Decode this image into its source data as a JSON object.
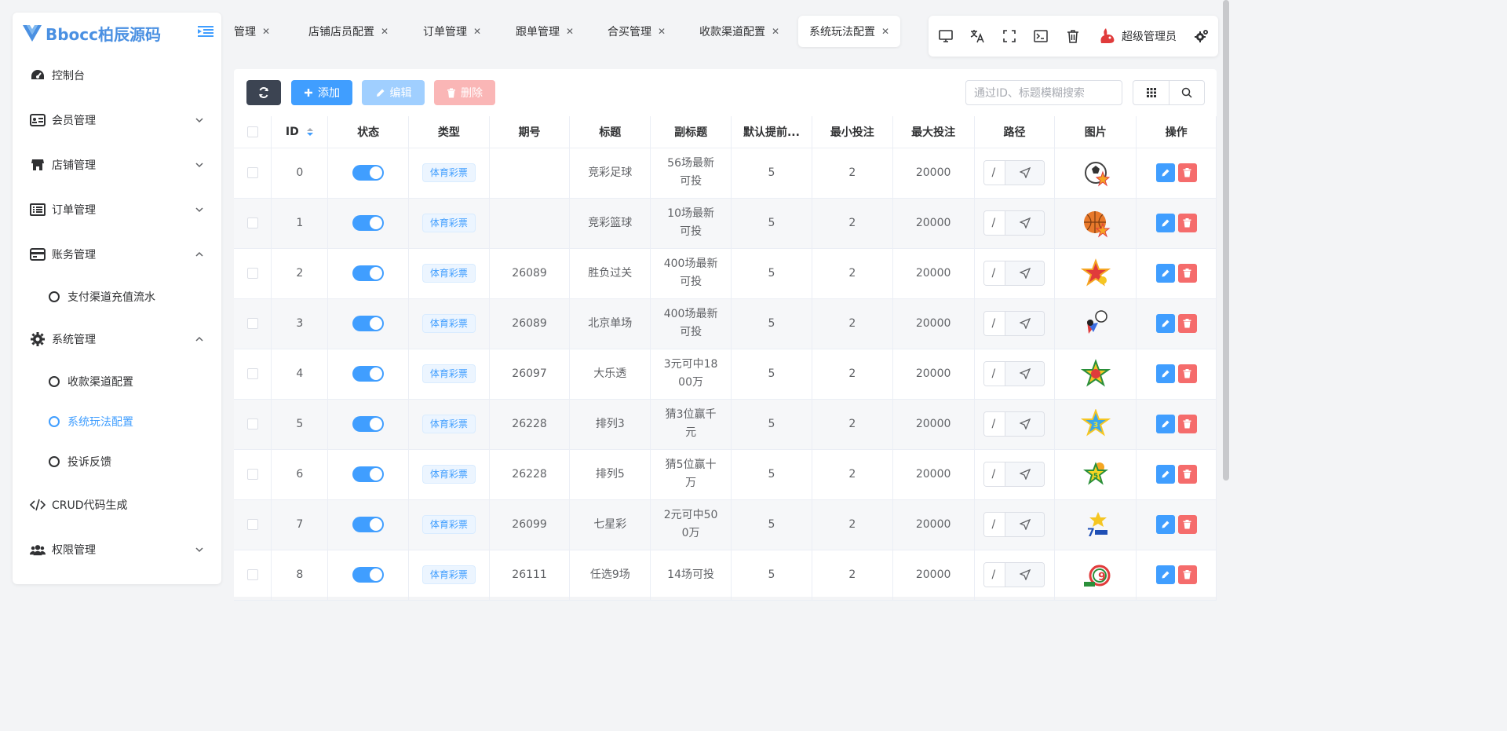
{
  "app": {
    "title": "Bbocc柏辰源码"
  },
  "sidebar": {
    "items": [
      {
        "label": "控制台",
        "icon": "dashboard-icon"
      },
      {
        "label": "会员管理",
        "icon": "id-card-icon"
      },
      {
        "label": "店铺管理",
        "icon": "store-icon"
      },
      {
        "label": "订单管理",
        "icon": "list-icon"
      },
      {
        "label": "账务管理",
        "icon": "credit-card-icon"
      },
      {
        "label": "系统管理",
        "icon": "gear-icon"
      },
      {
        "label": "CRUD代码生成",
        "icon": "code-icon"
      },
      {
        "label": "权限管理",
        "icon": "users-icon"
      }
    ],
    "finance_sub": [
      {
        "label": "支付渠道充值流水"
      }
    ],
    "system_sub": [
      {
        "label": "收款渠道配置"
      },
      {
        "label": "系统玩法配置"
      },
      {
        "label": "投诉反馈"
      }
    ]
  },
  "tabs": [
    {
      "label": "管理"
    },
    {
      "label": "店铺店员配置"
    },
    {
      "label": "订单管理"
    },
    {
      "label": "跟单管理"
    },
    {
      "label": "合买管理"
    },
    {
      "label": "收款渠道配置"
    },
    {
      "label": "系统玩法配置"
    }
  ],
  "header": {
    "user": "超级管理员"
  },
  "toolbar": {
    "add_label": "添加",
    "edit_label": "编辑",
    "delete_label": "删除",
    "search_placeholder": "通过ID、标题模糊搜索"
  },
  "table": {
    "columns": [
      "ID",
      "状态",
      "类型",
      "期号",
      "标题",
      "副标题",
      "默认提前...",
      "最小投注",
      "最大投注",
      "路径",
      "图片",
      "操作"
    ],
    "rows": [
      {
        "id": "0",
        "type": "体育彩票",
        "issue": "",
        "title": "竞彩足球",
        "subtitle": "56场最新可投",
        "advance": "5",
        "min": "2",
        "max": "20000",
        "path": "/"
      },
      {
        "id": "1",
        "type": "体育彩票",
        "issue": "",
        "title": "竞彩篮球",
        "subtitle": "10场最新可投",
        "advance": "5",
        "min": "2",
        "max": "20000",
        "path": "/"
      },
      {
        "id": "2",
        "type": "体育彩票",
        "issue": "26089",
        "title": "胜负过关",
        "subtitle": "400场最新可投",
        "advance": "5",
        "min": "2",
        "max": "20000",
        "path": "/"
      },
      {
        "id": "3",
        "type": "体育彩票",
        "issue": "26089",
        "title": "北京单场",
        "subtitle": "400场最新可投",
        "advance": "5",
        "min": "2",
        "max": "20000",
        "path": "/"
      },
      {
        "id": "4",
        "type": "体育彩票",
        "issue": "26097",
        "title": "大乐透",
        "subtitle": "3元可中1800万",
        "advance": "5",
        "min": "2",
        "max": "20000",
        "path": "/"
      },
      {
        "id": "5",
        "type": "体育彩票",
        "issue": "26228",
        "title": "排列3",
        "subtitle": "猜3位赢千元",
        "advance": "5",
        "min": "2",
        "max": "20000",
        "path": "/"
      },
      {
        "id": "6",
        "type": "体育彩票",
        "issue": "26228",
        "title": "排列5",
        "subtitle": "猜5位赢十万",
        "advance": "5",
        "min": "2",
        "max": "20000",
        "path": "/"
      },
      {
        "id": "7",
        "type": "体育彩票",
        "issue": "26099",
        "title": "七星彩",
        "subtitle": "2元可中500万",
        "advance": "5",
        "min": "2",
        "max": "20000",
        "path": "/"
      },
      {
        "id": "8",
        "type": "体育彩票",
        "issue": "26111",
        "title": "任选9场",
        "subtitle": "14场可投",
        "advance": "5",
        "min": "2",
        "max": "20000",
        "path": "/"
      }
    ]
  }
}
